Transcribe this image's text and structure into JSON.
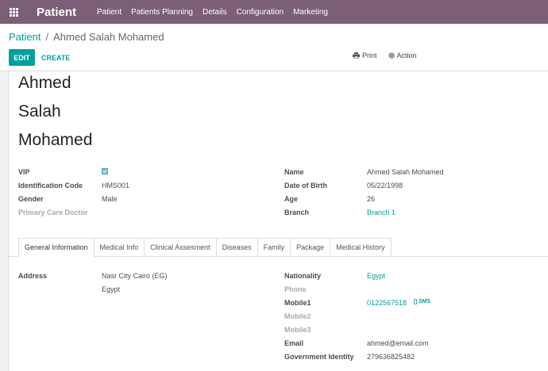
{
  "topbar": {
    "app_title": "Patient",
    "menu": [
      "Patient",
      "Patients Planning",
      "Details",
      "Configuration",
      "Marketing"
    ]
  },
  "breadcrumb": {
    "parent": "Patient",
    "separator": "/",
    "current": "Ahmed Salah Mohamed"
  },
  "toolbar": {
    "edit": "EDIT",
    "create": "CREATE",
    "print": "Print",
    "action": "Action"
  },
  "patient": {
    "name_lines": [
      "Ahmed",
      "Salah",
      "Mohamed"
    ]
  },
  "left_fields": {
    "vip_label": "VIP",
    "vip_checked": true,
    "id_code_label": "Identification Code",
    "id_code": "HMS001",
    "gender_label": "Gender",
    "gender": "Male",
    "pcd_label": "Primary Care Doctor"
  },
  "right_fields": {
    "name_label": "Name",
    "name": "Ahmed Salah Mohamed",
    "dob_label": "Date of Birth",
    "dob": "05/22/1998",
    "age_label": "Age",
    "age": "26",
    "branch_label": "Branch",
    "branch": "Branch 1"
  },
  "tabs": [
    "General Information",
    "Medical Info",
    "Clinical Assesment",
    "Diseases",
    "Family",
    "Package",
    "Medical History"
  ],
  "general": {
    "address_label": "Address",
    "address_line1": "Nasr City  Cairo (EG)",
    "address_line2": "Egypt",
    "nationality_label": "Nationality",
    "nationality": "Egypt",
    "phone_label": "Phone",
    "mobile1_label": "Mobile1",
    "mobile1": "0122567518",
    "sms": "SMS",
    "mobile2_label": "Mobile2",
    "mobile3_label": "Mobile3",
    "email_label": "Email",
    "email": "ahmed@email.com",
    "gov_label": "Government Identity",
    "gov_id": "279636825482"
  },
  "colors": {
    "topbar": "#7c5e76",
    "accent": "#00a09d"
  }
}
